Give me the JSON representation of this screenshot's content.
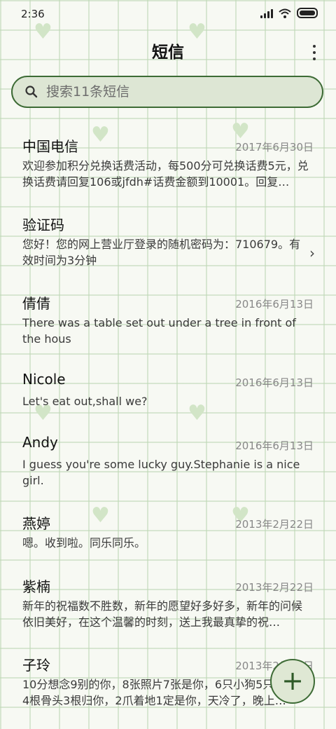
{
  "status": {
    "time": "2:36"
  },
  "header": {
    "title": "短信"
  },
  "search": {
    "placeholder": "搜索11条短信"
  },
  "messages": [
    {
      "name": "中国电信",
      "date": "2017年6月30日",
      "preview": "欢迎参加积分兑换话费活动，每500分可兑换话费5元，兑换话费请回复106或jfdh#话费金额到10001。回复…"
    },
    {
      "name": "验证码",
      "date": "",
      "preview": "您好！您的网上营业厅登录的随机密码为：710679。有效时间为3分钟"
    },
    {
      "name": "倩倩",
      "date": "2016年6月13日",
      "preview": "There was a table set out under a tree in front of the hous"
    },
    {
      "name": "Nicole",
      "date": "2016年6月13日",
      "preview": "Let's eat out,shall we?"
    },
    {
      "name": "Andy",
      "date": "2016年6月13日",
      "preview": "I guess you're some lucky guy.Stephanie is a nice girl."
    },
    {
      "name": "燕婷",
      "date": "2013年2月22日",
      "preview": "嗯。收到啦。同乐同乐。"
    },
    {
      "name": "紫楠",
      "date": "2013年2月22日",
      "preview": "新年的祝福数不胜数，新年的愿望好多好多，新年的问候依旧美好，在这个温馨的时刻，送上我最真挚的祝…"
    },
    {
      "name": "子玲",
      "date": "2013年2月22日",
      "preview": "10分想念9别的你，8张照片7张是你，6只小狗5只是你，4根骨头3根归你，2爪着地1定是你，天冷了，晚上…"
    }
  ],
  "fab": {
    "label": "+"
  },
  "colors": {
    "accent": "#3d6b35",
    "search_bg": "#dde6d4"
  }
}
